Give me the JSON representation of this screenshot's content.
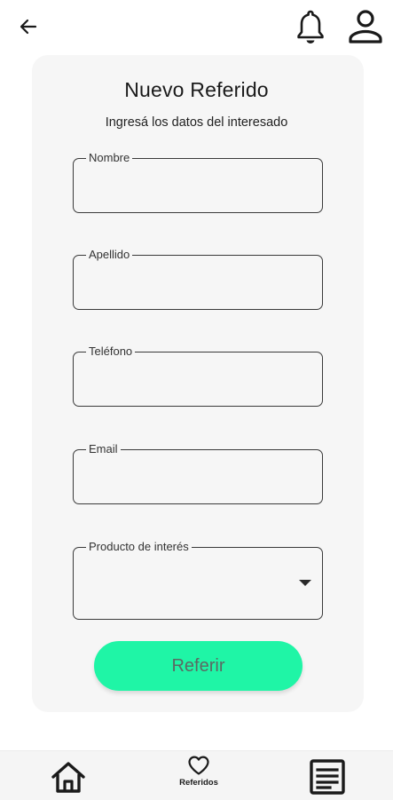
{
  "header": {
    "back_icon": "arrow-left-icon",
    "bell_icon": "bell-icon",
    "user_icon": "user-icon"
  },
  "form": {
    "title": "Nuevo Referido",
    "subtitle": "Ingresá los datos del interesado",
    "fields": [
      {
        "label": "Nombre",
        "value": ""
      },
      {
        "label": "Apellido",
        "value": ""
      },
      {
        "label": "Teléfono",
        "value": ""
      },
      {
        "label": "Email",
        "value": ""
      }
    ],
    "product": {
      "label": "Producto de interés",
      "value": ""
    },
    "submit_label": "Referir"
  },
  "nav": {
    "home_icon": "home-icon",
    "referrals_icon": "heart-icon",
    "referrals_label": "Referidos",
    "list_icon": "list-icon"
  },
  "colors": {
    "accent": "#1ff5a6",
    "card": "#f6f6f6"
  }
}
